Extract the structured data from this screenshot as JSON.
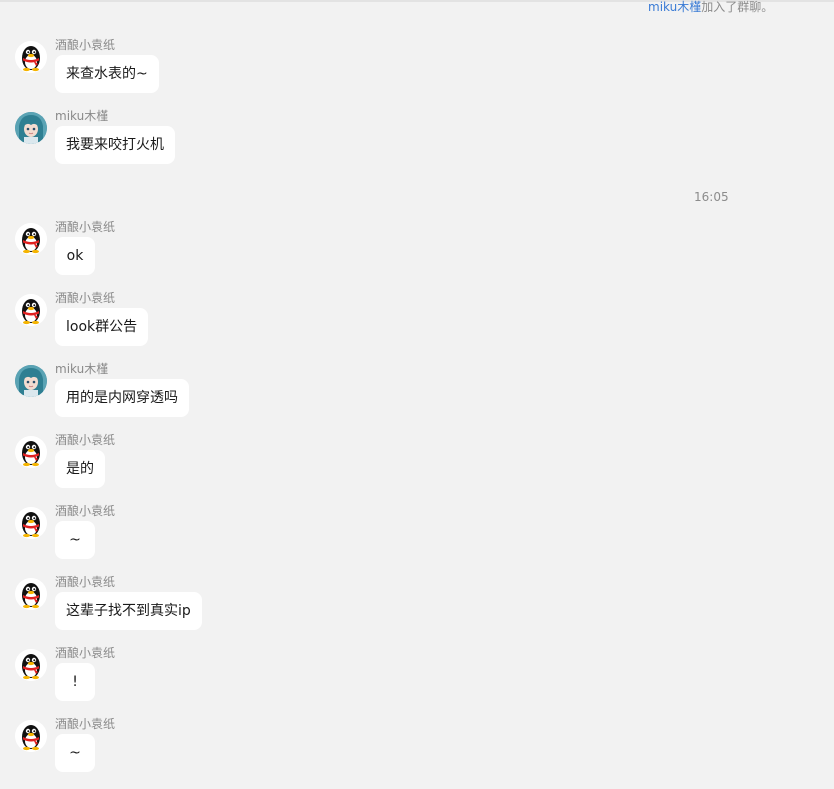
{
  "system_notice": {
    "name": "miku木槿",
    "text": "加入了群聊。"
  },
  "timestamp": "16:05",
  "colors": {
    "background": "#f2f2f2",
    "bubble": "#ffffff",
    "link": "#3a7bd5",
    "meta_text": "#8a8a8a"
  },
  "messages": [
    {
      "sender": "酒酿小袁纸",
      "text": "来查水表的~",
      "avatar": "penguin-avatar"
    },
    {
      "sender": "miku木槿",
      "text": "我要来咬打火机",
      "avatar": "anime-avatar"
    },
    {
      "sender": "酒酿小袁纸",
      "text": "ok",
      "avatar": "penguin-avatar"
    },
    {
      "sender": "酒酿小袁纸",
      "text": "look群公告",
      "avatar": "penguin-avatar"
    },
    {
      "sender": "miku木槿",
      "text": "用的是内网穿透吗",
      "avatar": "anime-avatar"
    },
    {
      "sender": "酒酿小袁纸",
      "text": "是的",
      "avatar": "penguin-avatar"
    },
    {
      "sender": "酒酿小袁纸",
      "text": "~",
      "avatar": "penguin-avatar"
    },
    {
      "sender": "酒酿小袁纸",
      "text": "这辈子找不到真实ip",
      "avatar": "penguin-avatar"
    },
    {
      "sender": "酒酿小袁纸",
      "text": "!",
      "avatar": "penguin-avatar"
    },
    {
      "sender": "酒酿小袁纸",
      "text": "~",
      "avatar": "penguin-avatar"
    }
  ]
}
